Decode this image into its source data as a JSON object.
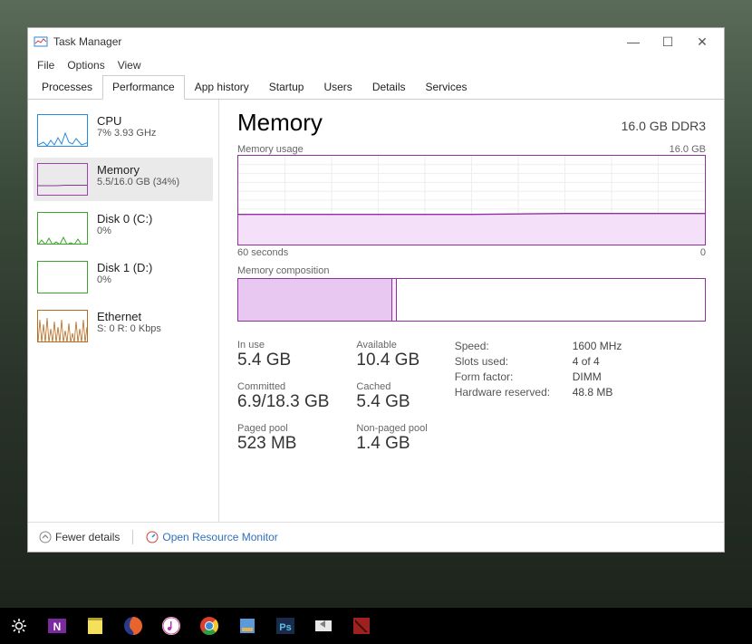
{
  "window": {
    "title": "Task Manager",
    "menu": [
      "File",
      "Options",
      "View"
    ],
    "controls": {
      "min": "—",
      "max": "☐",
      "close": "✕"
    }
  },
  "tabs": [
    "Processes",
    "Performance",
    "App history",
    "Startup",
    "Users",
    "Details",
    "Services"
  ],
  "active_tab": "Performance",
  "sidebar": [
    {
      "id": "cpu",
      "title": "CPU",
      "sub": "7%  3.93 GHz",
      "color": "#2a8adb"
    },
    {
      "id": "memory",
      "title": "Memory",
      "sub": "5.5/16.0 GB (34%)",
      "color": "#9030a0",
      "selected": true
    },
    {
      "id": "disk0",
      "title": "Disk 0 (C:)",
      "sub": "0%",
      "color": "#3aa52a"
    },
    {
      "id": "disk1",
      "title": "Disk 1 (D:)",
      "sub": "0%",
      "color": "#3aa52a"
    },
    {
      "id": "ethernet",
      "title": "Ethernet",
      "sub": "S: 0  R: 0 Kbps",
      "color": "#b86a1e"
    }
  ],
  "main": {
    "title": "Memory",
    "summary": "16.0 GB DDR3",
    "chart": {
      "label_left": "Memory usage",
      "label_right": "16.0 GB",
      "x_left": "60 seconds",
      "x_right": "0"
    },
    "composition_label": "Memory composition",
    "stats": {
      "in_use_label": "In use",
      "in_use": "5.4 GB",
      "available_label": "Available",
      "available": "10.4 GB",
      "committed_label": "Committed",
      "committed": "6.9/18.3 GB",
      "cached_label": "Cached",
      "cached": "5.4 GB",
      "paged_label": "Paged pool",
      "paged": "523 MB",
      "nonpaged_label": "Non-paged pool",
      "nonpaged": "1.4 GB"
    },
    "details": [
      {
        "k": "Speed:",
        "v": "1600 MHz"
      },
      {
        "k": "Slots used:",
        "v": "4 of 4"
      },
      {
        "k": "Form factor:",
        "v": "DIMM"
      },
      {
        "k": "Hardware reserved:",
        "v": "48.8 MB"
      }
    ]
  },
  "footer": {
    "fewer_details": "Fewer details",
    "resource_monitor": "Open Resource Monitor"
  },
  "chart_data": {
    "type": "line",
    "title": "Memory usage",
    "xlabel": "seconds",
    "ylabel": "GB",
    "ylim": [
      0,
      16.0
    ],
    "xlim": [
      60,
      0
    ],
    "x": [
      60,
      50,
      40,
      30,
      20,
      10,
      0
    ],
    "values": [
      5.5,
      5.5,
      5.5,
      5.5,
      5.5,
      5.6,
      5.6
    ]
  },
  "composition_data": {
    "segments": [
      {
        "name": "in_use_compressed",
        "fraction": 0.33
      },
      {
        "name": "modified",
        "fraction": 0.01
      },
      {
        "name": "standby_free",
        "fraction": 0.66
      }
    ]
  }
}
